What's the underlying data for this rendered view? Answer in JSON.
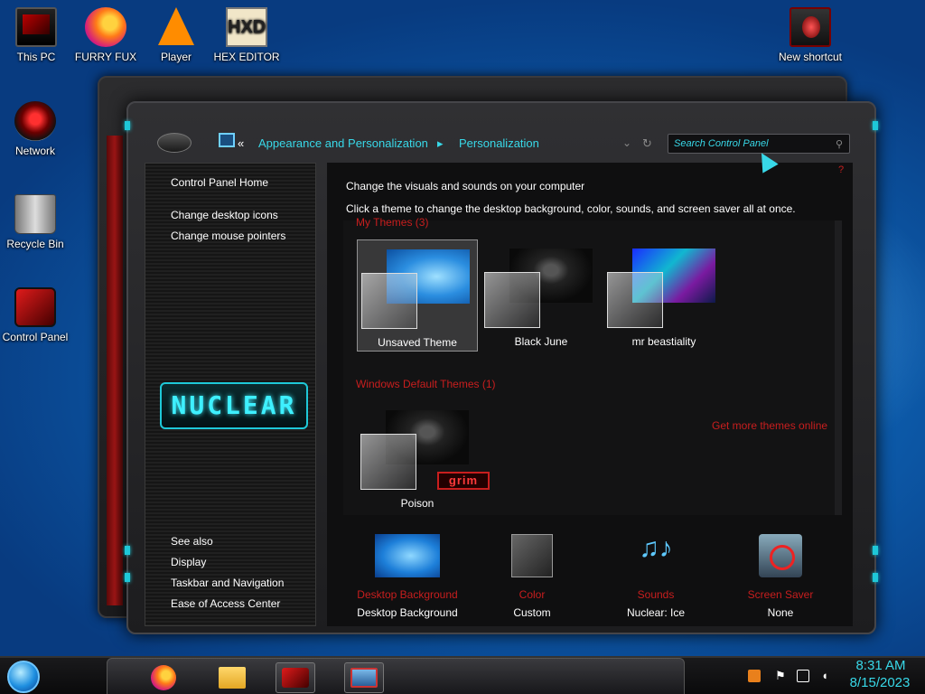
{
  "desktop": {
    "icons": [
      {
        "label": "This PC",
        "icon": "computer-icon"
      },
      {
        "label": "FURRY FUX",
        "icon": "firefox-icon"
      },
      {
        "label": "Player",
        "icon": "vlc-icon"
      },
      {
        "label": "HEX EDITOR",
        "icon": "hex-editor-icon"
      },
      {
        "label": "New shortcut",
        "icon": "shortcut-icon"
      },
      {
        "label": "Network",
        "icon": "network-icon"
      },
      {
        "label": "Recycle Bin",
        "icon": "recycle-bin-icon"
      },
      {
        "label": "Control Panel",
        "icon": "control-panel-icon"
      }
    ]
  },
  "window": {
    "breadcrumb": {
      "root_chevron": "«",
      "items": [
        "Appearance and Personalization",
        "Personalization"
      ],
      "separator": "▸"
    },
    "search": {
      "placeholder": "Search Control Panel"
    },
    "left_pane": {
      "top_links": [
        "Control Panel Home",
        "Change desktop icons",
        "Change mouse pointers"
      ],
      "logo_text": "NUCLEAR",
      "see_also_title": "See also",
      "see_also_links": [
        "Display",
        "Taskbar and Navigation",
        "Ease of Access Center"
      ]
    },
    "main": {
      "heading": "Change the visuals and sounds on your computer",
      "subheading": "Click a theme to change the desktop background, color, sounds, and screen saver all at once.",
      "my_themes_title": "My Themes (3)",
      "my_themes": [
        {
          "name": "Unsaved Theme",
          "selected": true
        },
        {
          "name": "Black June",
          "selected": false
        },
        {
          "name": "mr beastiality",
          "selected": false
        }
      ],
      "get_more_link": "Get more themes online",
      "default_themes_title": "Windows Default Themes (1)",
      "default_themes": [
        {
          "name": "Poison",
          "badge": "grim"
        }
      ],
      "bottom_settings": [
        {
          "label": "Desktop Background",
          "value": "Desktop Background",
          "icon": "wallpaper-icon"
        },
        {
          "label": "Color",
          "value": "Custom",
          "icon": "color-swatch-icon"
        },
        {
          "label": "Sounds",
          "value": "Nuclear: Ice",
          "icon": "music-notes-icon"
        },
        {
          "label": "Screen Saver",
          "value": "None",
          "icon": "screen-saver-icon"
        }
      ]
    }
  },
  "taskbar": {
    "clock": {
      "time": "8:31 AM",
      "date": "8/15/2023"
    },
    "pinned": [
      "firefox-icon",
      "file-explorer-icon",
      "control-panel-icon",
      "remote-desktop-icon"
    ],
    "tray": [
      "warning-icon",
      "flag-icon",
      "network-icon",
      "volume-muted-icon"
    ]
  },
  "colors": {
    "accent_cyan": "#38d8e8",
    "accent_red": "#c81e1e",
    "window_dark": "#0f0f10"
  }
}
